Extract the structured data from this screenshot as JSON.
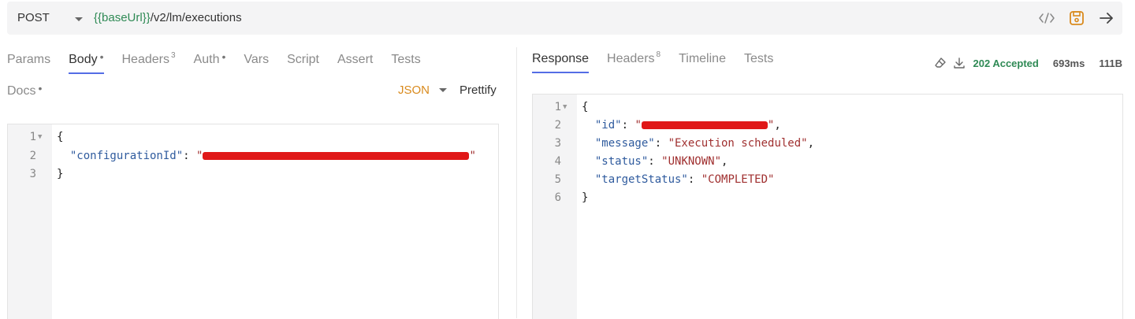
{
  "request": {
    "method": "POST",
    "url_var": "{{baseUrl}}",
    "url_path": "/v2/lm/executions"
  },
  "left_tabs": [
    {
      "label": "Params",
      "active": false,
      "badge": "",
      "dot": ""
    },
    {
      "label": "Body",
      "active": true,
      "badge": "",
      "dot": "•"
    },
    {
      "label": "Headers",
      "active": false,
      "badge": "3",
      "dot": ""
    },
    {
      "label": "Auth",
      "active": false,
      "badge": "",
      "dot": "•"
    },
    {
      "label": "Vars",
      "active": false,
      "badge": "",
      "dot": ""
    },
    {
      "label": "Script",
      "active": false,
      "badge": "",
      "dot": ""
    },
    {
      "label": "Assert",
      "active": false,
      "badge": "",
      "dot": ""
    },
    {
      "label": "Tests",
      "active": false,
      "badge": "",
      "dot": ""
    }
  ],
  "docs_tab": {
    "label": "Docs",
    "dot": "•"
  },
  "body_mode": {
    "selected": "JSON",
    "prettify": "Prettify"
  },
  "request_body": {
    "line_numbers": [
      "1",
      "2",
      "3"
    ],
    "open": "{",
    "key": "\"configurationId\"",
    "colon": ": ",
    "quote": "\"",
    "close": "}"
  },
  "right_tabs": [
    {
      "label": "Response",
      "active": true,
      "badge": ""
    },
    {
      "label": "Headers",
      "active": false,
      "badge": "8"
    },
    {
      "label": "Timeline",
      "active": false,
      "badge": ""
    },
    {
      "label": "Tests",
      "active": false,
      "badge": ""
    }
  ],
  "response_meta": {
    "status": "202 Accepted",
    "time": "693ms",
    "size": "111B"
  },
  "response_body": {
    "line_numbers": [
      "1",
      "2",
      "3",
      "4",
      "5",
      "6"
    ],
    "open": "{",
    "id_key": "\"id\"",
    "message_key": "\"message\"",
    "message_val": "\"Execution scheduled\"",
    "status_key": "\"status\"",
    "status_val": "\"UNKNOWN\"",
    "target_key": "\"targetStatus\"",
    "target_val": "\"COMPLETED\"",
    "close": "}"
  },
  "colors": {
    "accent": "#546de5",
    "success": "#2f8a55",
    "json_label": "#d98a1d",
    "redaction": "#e01818"
  }
}
